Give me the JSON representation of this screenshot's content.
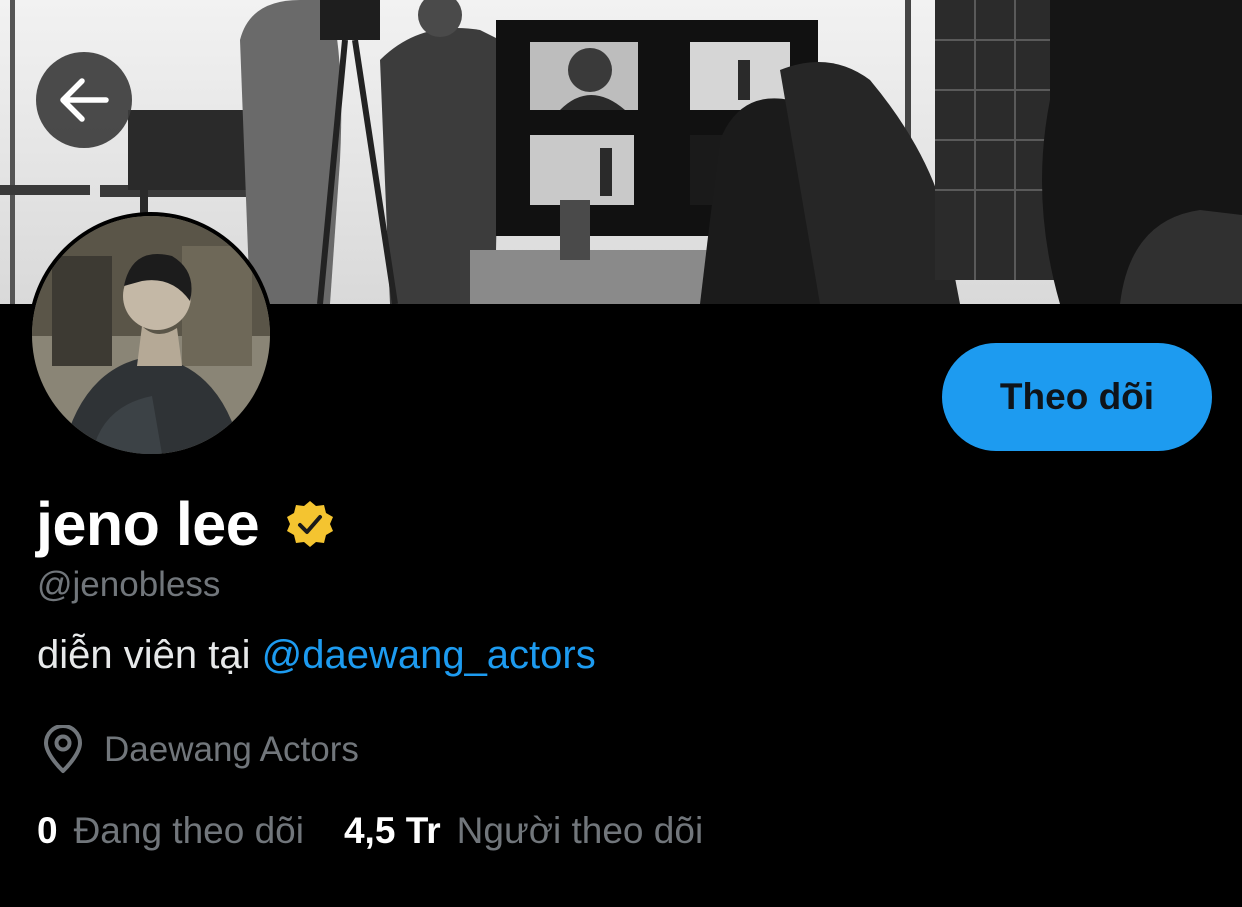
{
  "header": {
    "back_icon": "arrow-left-icon",
    "banner_description": ""
  },
  "profile": {
    "display_name": "jeno lee",
    "verified_icon": "verified-badge-icon",
    "verified_color": "#f4c430",
    "handle": "@jenobless",
    "bio_text": "diễn viên tại ",
    "bio_mention": "@daewang_actors",
    "location_icon": "location-pin-icon",
    "location": "Daewang Actors"
  },
  "actions": {
    "follow_label": "Theo dõi"
  },
  "stats": [
    {
      "count": "0",
      "label": "Đang theo dõi"
    },
    {
      "count": "4,5 Tr",
      "label": "Người theo dõi"
    }
  ],
  "colors": {
    "accent": "#1d9bf0",
    "background": "#000000",
    "secondary_text": "#71767b"
  }
}
